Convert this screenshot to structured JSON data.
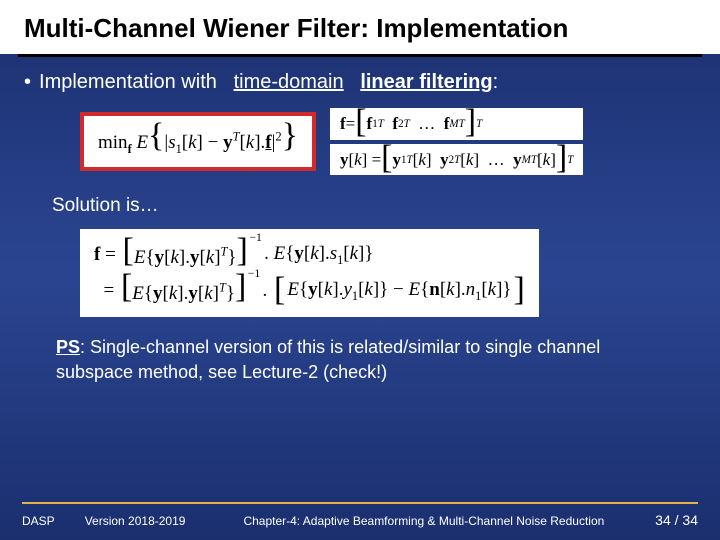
{
  "title": "Multi-Channel Wiener Filter: Implementation",
  "bullet": {
    "lead": "Implementation with",
    "u1": "time-domain",
    "u2": "linear filtering",
    "tail": ":"
  },
  "eq_main": "min_𝐟 E{ |s₁[k] − 𝐲ᵀ[k].𝐟|² }",
  "eq_fdef": "𝐟 = [𝐟₁ᵀ  𝐟₂ᵀ  …  𝐟ₘᵀ]ᵀ",
  "eq_ydef": "𝐲[k] = [𝐲₁ᵀ[k]  𝐲₂ᵀ[k]  …  𝐲ₘᵀ[k]]ᵀ",
  "solution_label": "Solution is…",
  "eq_line1": {
    "lhs": "𝐟 =",
    "br_l": "[",
    "mid": "E{𝐲[k].𝐲[k]ᵀ}",
    "br_r": "]",
    "exp": "−1",
    "rhs": ". E{𝐲[k].s₁[k]}"
  },
  "eq_line2": {
    "lhs": "=",
    "br_l": "[",
    "mid": "E{𝐲[k].𝐲[k]ᵀ}",
    "br_r": "]",
    "exp": "−1",
    "rhs1": ".",
    "br2_l": "[",
    "rhs2": "E{𝐲[k].y₁[k]} − E{𝐧[k].n₁[k]}",
    "br2_r": "]"
  },
  "ps": {
    "label": "PS",
    "text": ":  Single-channel version of this is related/similar to single channel subspace method, see Lecture-2 (check!)"
  },
  "footer": {
    "course": "DASP",
    "version": "Version 2018-2019",
    "chapter": "Chapter-4: Adaptive Beamforming & Multi-Channel Noise Reduction",
    "page": "34 / 34"
  }
}
